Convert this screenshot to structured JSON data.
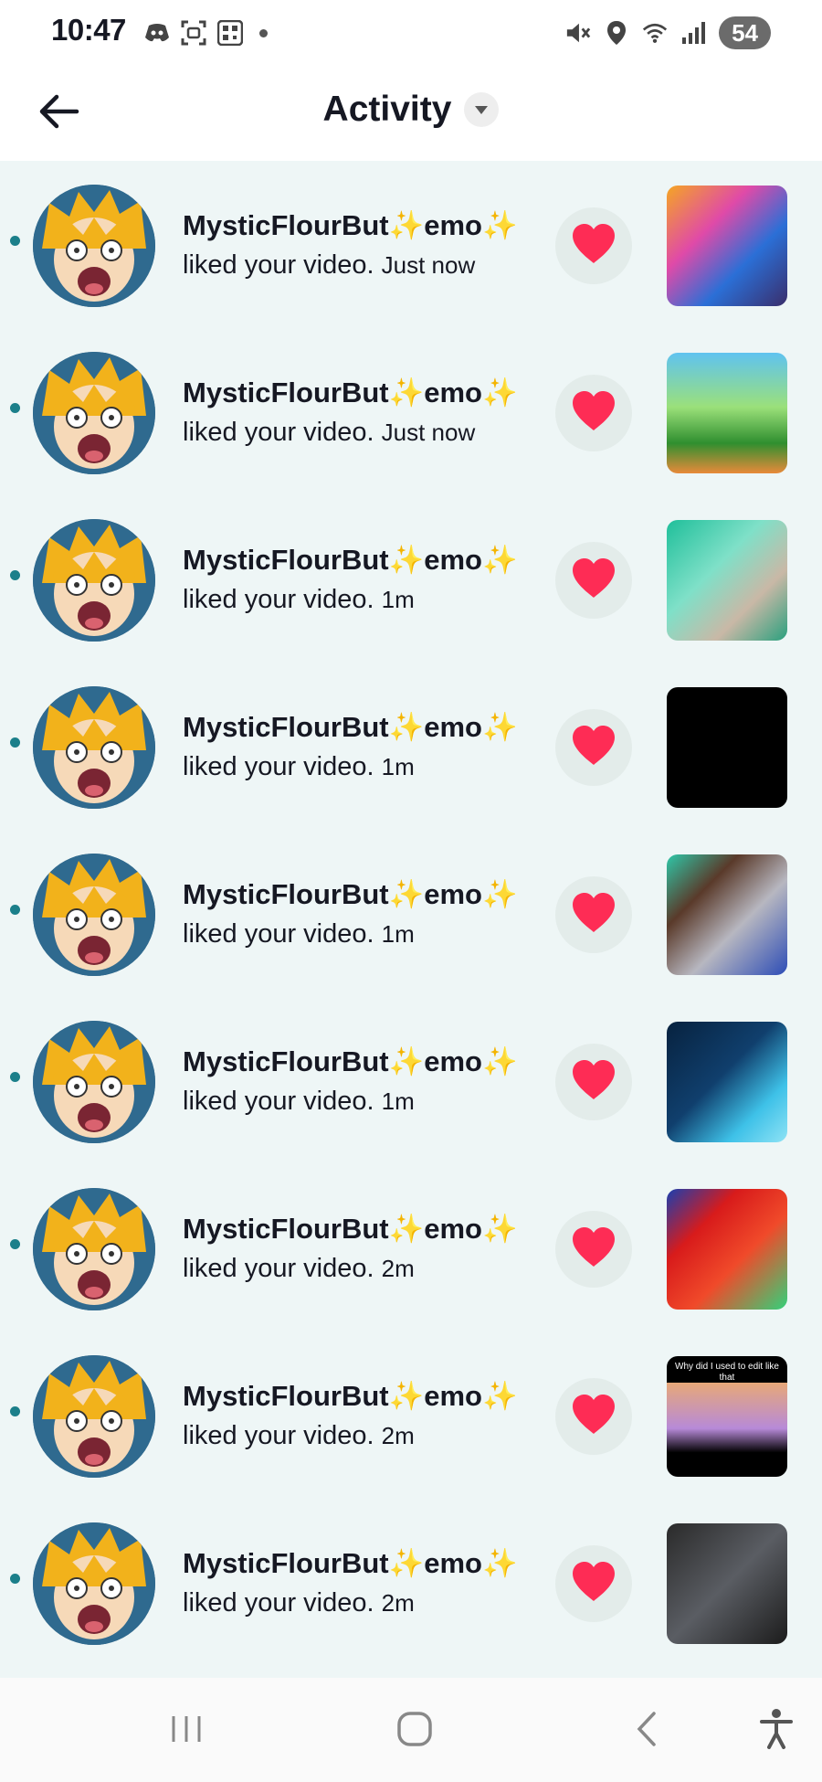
{
  "status_bar": {
    "time": "10:47",
    "battery": "54",
    "left_icons": [
      "discord-icon",
      "screenshot-icon",
      "qr-icon",
      "dot-icon"
    ],
    "right_icons": [
      "mute-icon",
      "location-icon",
      "wifi-icon",
      "signal-icon"
    ]
  },
  "header": {
    "title": "Activity",
    "back_icon": "arrow-left-icon",
    "dropdown_icon": "caret-down-icon"
  },
  "notifications": [
    {
      "username": "MysticFlourBut✨emo✨",
      "action": "liked your video.",
      "time": "Just now",
      "thumb": "game"
    },
    {
      "username": "MysticFlourBut✨emo✨",
      "action": "liked your video.",
      "time": "Just now",
      "thumb": "grass"
    },
    {
      "username": "MysticFlourBut✨emo✨",
      "action": "liked your video.",
      "time": "1m",
      "thumb": "teal"
    },
    {
      "username": "MysticFlourBut✨emo✨",
      "action": "liked your video.",
      "time": "1m",
      "thumb": "black"
    },
    {
      "username": "MysticFlourBut✨emo✨",
      "action": "liked your video.",
      "time": "1m",
      "thumb": "brown"
    },
    {
      "username": "MysticFlourBut✨emo✨",
      "action": "liked your video.",
      "time": "1m",
      "thumb": "cloud"
    },
    {
      "username": "MysticFlourBut✨emo✨",
      "action": "liked your video.",
      "time": "2m",
      "thumb": "red"
    },
    {
      "username": "MysticFlourBut✨emo✨",
      "action": "liked your video.",
      "time": "2m",
      "thumb": "room",
      "caption": "Why did I used to edit like that"
    },
    {
      "username": "MysticFlourBut✨emo✨",
      "action": "liked your video.",
      "time": "2m",
      "thumb": "cat"
    }
  ],
  "nav": {
    "icons": [
      "recents-icon",
      "home-icon",
      "back-icon",
      "accessibility-icon"
    ]
  },
  "colors": {
    "list_bg": "#eef6f6",
    "unread_dot": "#1b7f8a",
    "heart": "#fe2c55",
    "like_bg": "#e3ecea"
  }
}
